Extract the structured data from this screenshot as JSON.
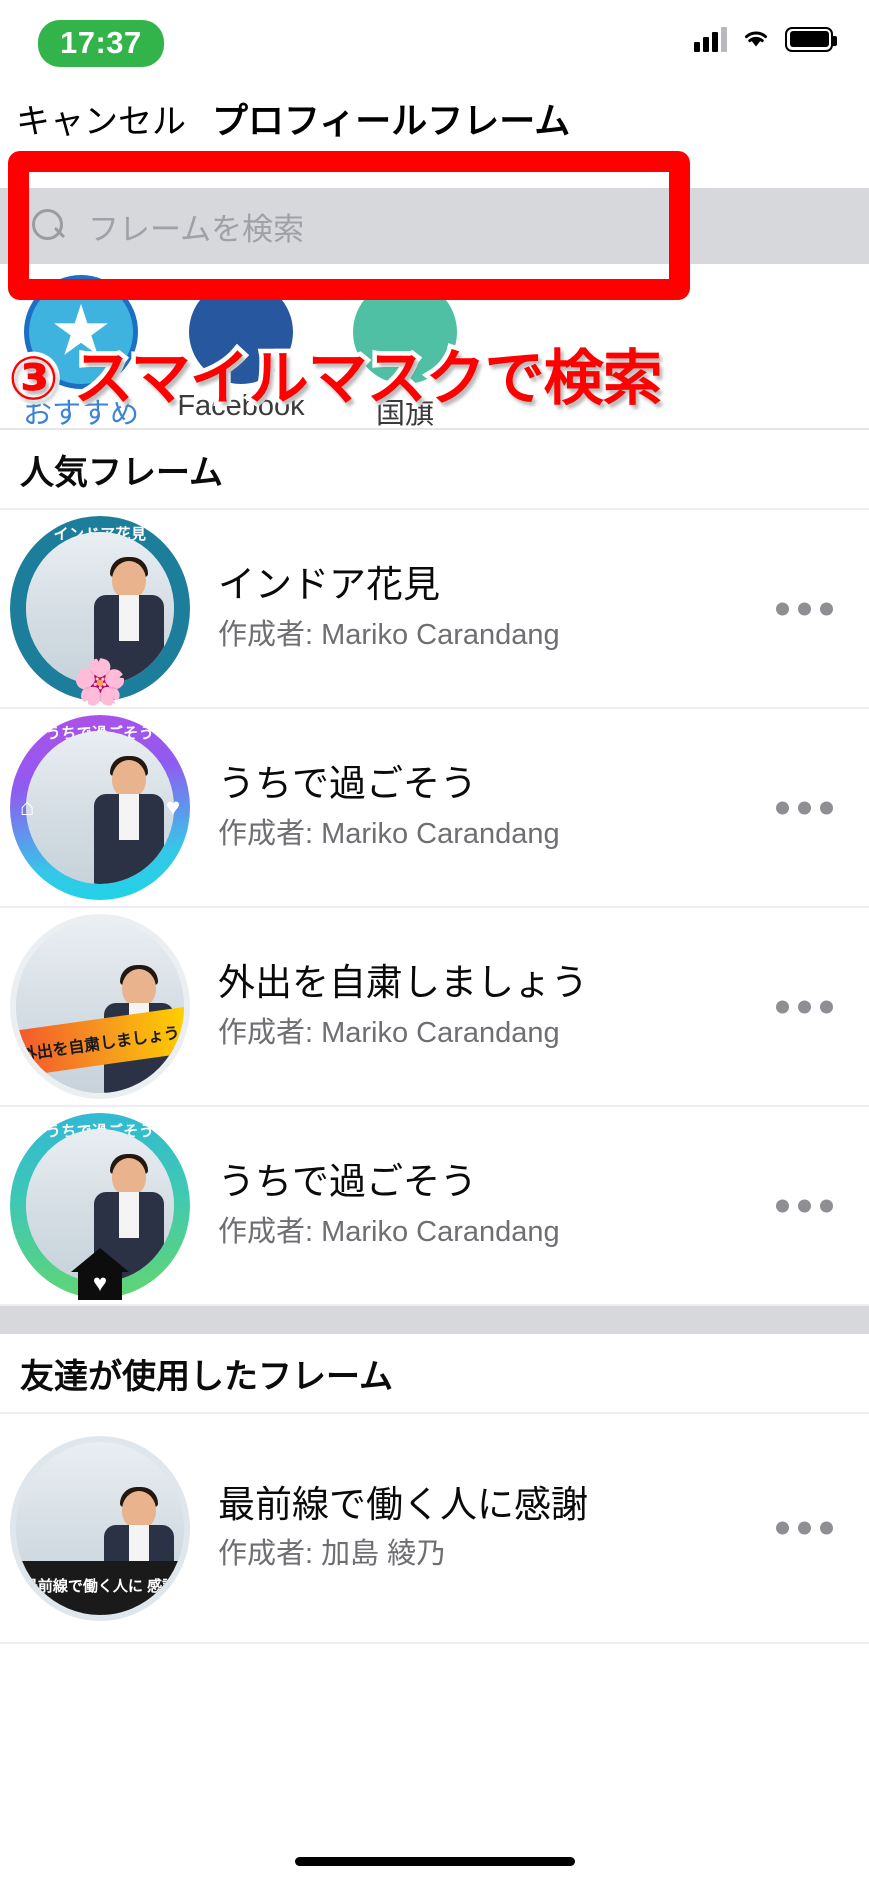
{
  "status_bar": {
    "time": "17:37",
    "signal_icon": "cellular-signal-icon",
    "wifi_icon": "wifi-icon",
    "battery_icon": "battery-icon"
  },
  "nav": {
    "cancel_label": "キャンセル",
    "title": "プロフィールフレーム"
  },
  "search": {
    "placeholder": "フレームを検索",
    "value": "",
    "icon": "search-icon"
  },
  "annotation": {
    "text": "③ スマイルマスクで検索",
    "box_color": "#ff0000",
    "text_color": "#ff0000"
  },
  "tabs": [
    {
      "label": "おすすめ",
      "selected": true,
      "icon": "star-badge-icon",
      "color": "#3fb3e0"
    },
    {
      "label": "Facebook",
      "selected": false,
      "icon": "facebook-icon",
      "color": "#27589f"
    },
    {
      "label": "国旗",
      "selected": false,
      "icon": "flag-icon",
      "color": "#4fc0a4"
    }
  ],
  "sections": [
    {
      "heading": "人気フレーム",
      "items": [
        {
          "title": "インドア花見",
          "author": "作成者: Mariko Carandang",
          "ring_label": "インドア花見",
          "ring_color": "#1d7e9c",
          "decor": "sakura"
        },
        {
          "title": "うちで過ごそう",
          "author": "作成者: Mariko Carandang",
          "ring_label": "うちで過ごそう",
          "ring_color": "#b14fe8",
          "decor": "home-heart"
        },
        {
          "title": "外出を自粛しましょう",
          "author": "作成者: Mariko Carandang",
          "ring_label": "",
          "ring_color": "#eceff2",
          "decor": "banner",
          "banner_text": "外出を自粛しましょう"
        },
        {
          "title": "うちで過ごそう",
          "author": "作成者: Mariko Carandang",
          "ring_label": "うちで過ごそう",
          "ring_color": "#3fc0c8",
          "decor": "house"
        }
      ]
    },
    {
      "heading": "友達が使用したフレーム",
      "items": [
        {
          "title": "最前線で働く人に感謝",
          "author": "作成者: 加島 綾乃",
          "ring_label": "",
          "ring_color": "#dfe6ec",
          "decor": "banner2",
          "banner_text": "最前線で働く人に 感謝"
        }
      ]
    }
  ],
  "overflow_menu_icon": "more-options-icon"
}
